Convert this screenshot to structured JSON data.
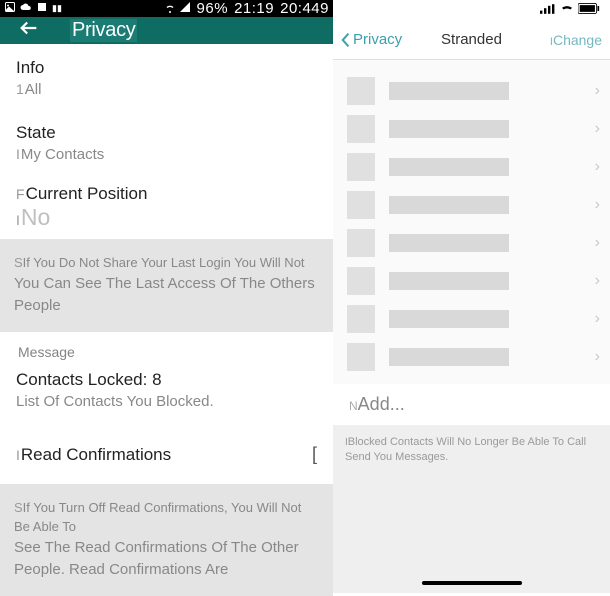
{
  "android": {
    "status": {
      "battery_pct": "96%",
      "time": "21:19",
      "extra": "20:449"
    },
    "header": {
      "title": "Privacy"
    },
    "rows": {
      "info": {
        "label": "Info",
        "value": "All",
        "prefix": "1"
      },
      "state": {
        "label": "State",
        "value": "My Contacts",
        "prefix": "I"
      },
      "position": {
        "label": "Current Position",
        "value": "No",
        "labelPrefix": "F",
        "valuePrefix": "I"
      }
    },
    "note1": {
      "s1pre": "S",
      "line1": "If You Do Not Share Your Last Login You Will Not",
      "line2": "You Can See The Last Access Of The Others",
      "line3": "People"
    },
    "section": "Message",
    "blocked": {
      "label": "Contacts Locked: 8",
      "sub": "List Of Contacts You Blocked."
    },
    "read": {
      "label": "Read Confirmations",
      "labelPrefix": "I",
      "switchGlyph": "["
    },
    "note2": {
      "pre": "S",
      "l1": "If You Turn Off Read Confirmations, You Will Not Be Able To",
      "l2": "See The Read Confirmations Of The Other",
      "l3": "People. Read Confirmations Are"
    }
  },
  "ios": {
    "header": {
      "back": "Privacy",
      "title": "Stranded",
      "change": "Change",
      "changePrefix": "I"
    },
    "add": {
      "label": "Add...",
      "prefix": "N"
    },
    "footer": {
      "pre": "I",
      "text": "Blocked Contacts Will No Longer Be Able To Call Send You Messages."
    }
  }
}
